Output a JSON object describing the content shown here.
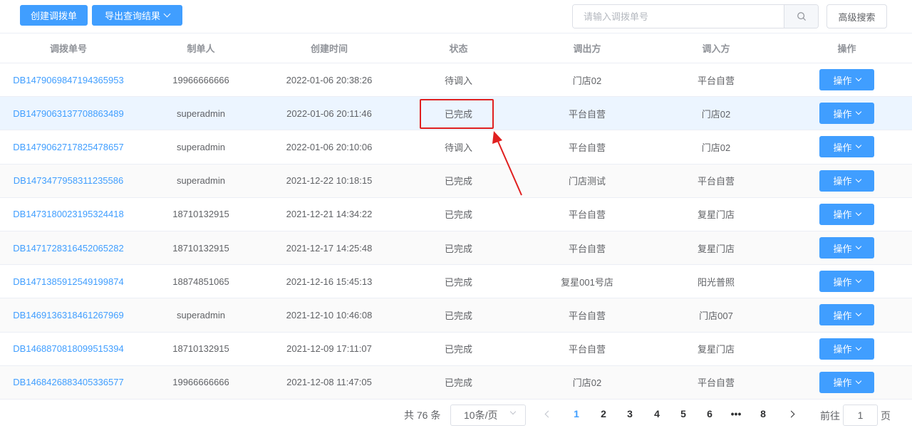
{
  "toolbar": {
    "create_label": "创建调拨单",
    "export_label": "导出查询结果",
    "search_placeholder": "请输入调拨单号",
    "advanced_label": "高级搜索"
  },
  "table": {
    "headers": [
      "调拨单号",
      "制单人",
      "创建时间",
      "状态",
      "调出方",
      "调入方",
      "操作"
    ],
    "action_label": "操作",
    "rows": [
      {
        "id": "DB1479069847194365953",
        "creator": "19966666666",
        "created": "2022-01-06 20:38:26",
        "status": "待调入",
        "from": "门店02",
        "to": "平台自营"
      },
      {
        "id": "DB1479063137708863489",
        "creator": "superadmin",
        "created": "2022-01-06 20:11:46",
        "status": "已完成",
        "from": "平台自营",
        "to": "门店02"
      },
      {
        "id": "DB1479062717825478657",
        "creator": "superadmin",
        "created": "2022-01-06 20:10:06",
        "status": "待调入",
        "from": "平台自营",
        "to": "门店02"
      },
      {
        "id": "DB1473477958311235586",
        "creator": "superadmin",
        "created": "2021-12-22 10:18:15",
        "status": "已完成",
        "from": "门店测试",
        "to": "平台自营"
      },
      {
        "id": "DB1473180023195324418",
        "creator": "18710132915",
        "created": "2021-12-21 14:34:22",
        "status": "已完成",
        "from": "平台自营",
        "to": "复星门店"
      },
      {
        "id": "DB1471728316452065282",
        "creator": "18710132915",
        "created": "2021-12-17 14:25:48",
        "status": "已完成",
        "from": "平台自营",
        "to": "复星门店"
      },
      {
        "id": "DB1471385912549199874",
        "creator": "18874851065",
        "created": "2021-12-16 15:45:13",
        "status": "已完成",
        "from": "复星001号店",
        "to": "阳光普照"
      },
      {
        "id": "DB1469136318461267969",
        "creator": "superadmin",
        "created": "2021-12-10 10:46:08",
        "status": "已完成",
        "from": "平台自营",
        "to": "门店007"
      },
      {
        "id": "DB1468870818099515394",
        "creator": "18710132915",
        "created": "2021-12-09 17:11:07",
        "status": "已完成",
        "from": "平台自营",
        "to": "复星门店"
      },
      {
        "id": "DB1468426883405336577",
        "creator": "19966666666",
        "created": "2021-12-08 11:47:05",
        "status": "已完成",
        "from": "门店02",
        "to": "平台自营"
      }
    ]
  },
  "pagination": {
    "total_text": "共 76 条",
    "page_size": "10条/页",
    "pages": [
      "1",
      "2",
      "3",
      "4",
      "5",
      "6",
      "•••",
      "8"
    ],
    "current_page": "1",
    "goto_label": "前往",
    "goto_value": "1",
    "goto_unit": "页"
  },
  "annotation": {
    "color": "#e02020",
    "highlight_row_index": 1
  },
  "colors": {
    "primary": "#409eff",
    "highlight_row_bg": "#ecf5ff"
  }
}
